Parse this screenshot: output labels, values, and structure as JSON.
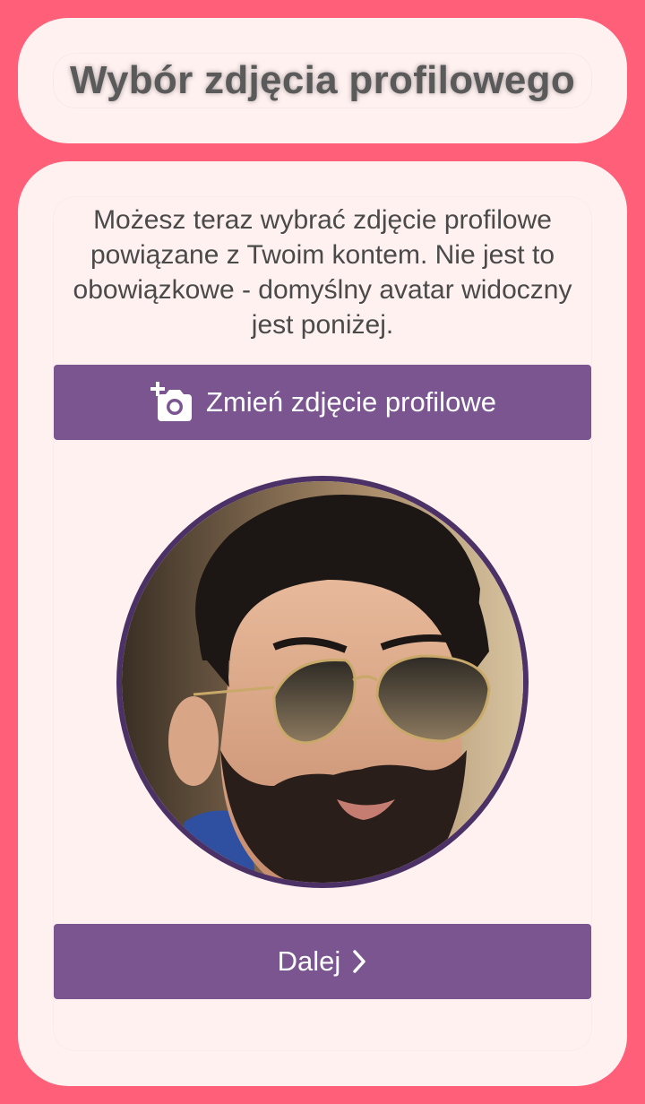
{
  "header": {
    "title": "Wybór zdjęcia profilowego"
  },
  "main": {
    "description": "Możesz teraz wybrać zdjęcie profilowe powiązane z Twoim kontem. Nie jest to obowiązkowe - domyślny avatar widoczny jest poniżej.",
    "change_photo_button": {
      "label": "Zmień zdjęcie profilowe",
      "icon": "add-a-photo-icon"
    },
    "avatar": {
      "description": "profile photo"
    },
    "next_button": {
      "label": "Dalej",
      "icon": "chevron-right-icon"
    }
  },
  "colors": {
    "page_background": "#ff5f78",
    "card_background": "#fff1f0",
    "button_background": "#7a5590",
    "avatar_border": "#4b3166",
    "title_text": "#5a5a5a",
    "body_text": "#4a4a4a"
  }
}
